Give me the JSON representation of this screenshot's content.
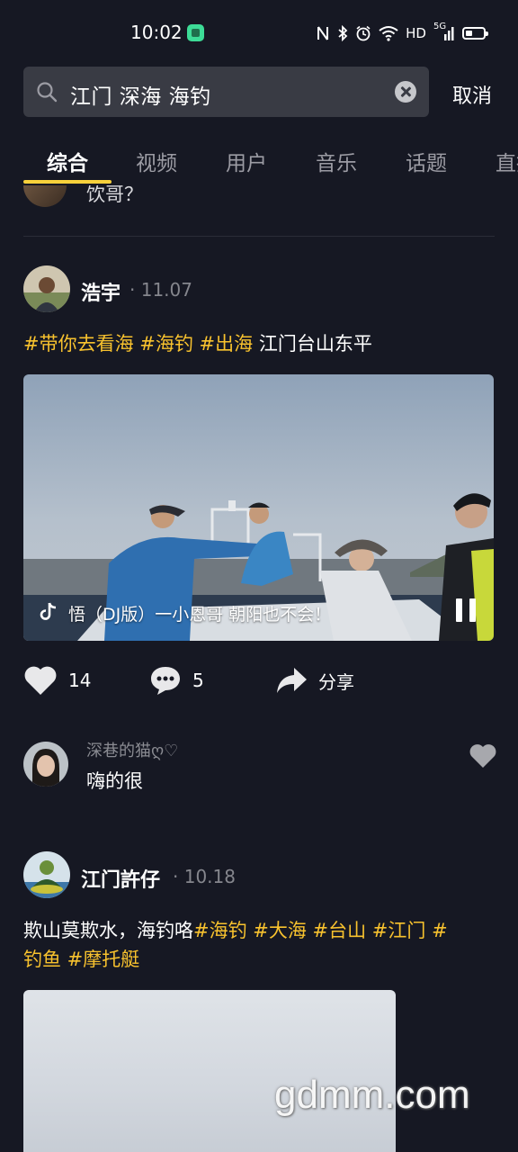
{
  "status_bar": {
    "time": "10:02",
    "hd_label": "HD",
    "network_label": "5G"
  },
  "search": {
    "query": "江门 深海 海钓",
    "cancel_label": "取消"
  },
  "tabs": [
    {
      "label": "综合",
      "active": true
    },
    {
      "label": "视频",
      "active": false
    },
    {
      "label": "用户",
      "active": false
    },
    {
      "label": "音乐",
      "active": false
    },
    {
      "label": "话题",
      "active": false
    },
    {
      "label": "直播",
      "active": false
    }
  ],
  "previous_snippet": {
    "text": "饮哥？"
  },
  "posts": [
    {
      "author": "浩宇",
      "date": "· 11.07",
      "caption_tags": "#带你去看海 #海钓 #出海",
      "caption_text": " 江门台山东平",
      "music": "悟（DJ版）一小恩哥  朝阳也不会！",
      "likes": "14",
      "comments": "5",
      "share_label": "分享",
      "top_comment": {
        "user": "深巷的猫ღ♡",
        "text": "嗨的很"
      }
    },
    {
      "author": "江门許仔",
      "date": "· 10.18",
      "caption_text": "欺山莫欺水，海钓咯",
      "caption_tags_line1": "#海钓 #大海 #台山 #江门 #",
      "caption_tags_line2": "钓鱼 #摩托艇"
    }
  ],
  "watermark": "gdmm.com",
  "colors": {
    "background": "#161823",
    "accent_tag": "#f8c22e",
    "tab_underline": "#f8d13b",
    "search_bg": "#393b44"
  }
}
